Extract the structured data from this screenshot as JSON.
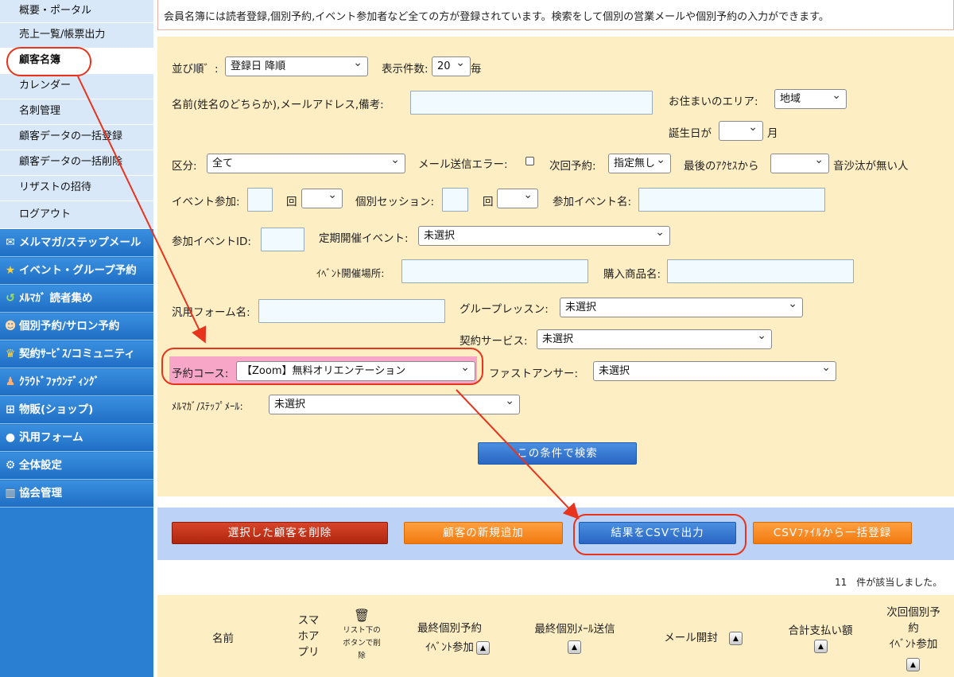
{
  "sidebar": {
    "sub_items": [
      {
        "label": "概要・ポータル"
      },
      {
        "label": "売上一覧/帳票出力"
      },
      {
        "label": "顧客名簿"
      },
      {
        "label": "カレンダー"
      },
      {
        "label": "名刺管理"
      },
      {
        "label": "顧客データの一括登録"
      },
      {
        "label": "顧客データの一括削除"
      },
      {
        "label": "リザストの招待"
      },
      {
        "label": "ログアウト"
      }
    ],
    "main_items": [
      {
        "label": "メルマガ/ステップメール",
        "icon": "envelope-icon"
      },
      {
        "label": "イベント・グループ予約",
        "icon": "star-icon"
      },
      {
        "label": "ﾒﾙﾏｶﾞ 読者集め",
        "icon": "recycle-icon"
      },
      {
        "label": "個別予約/サロン予約",
        "icon": "group-icon"
      },
      {
        "label": "契約ｻｰﾋﾞｽ/コミュニティ",
        "icon": "trophy-icon"
      },
      {
        "label": "ｸﾗｳﾄﾞﾌｧｳﾝﾃﾞｨﾝｸﾞ",
        "icon": "person-icon"
      },
      {
        "label": "物販(ショップ)",
        "icon": "cart-icon"
      },
      {
        "label": "汎用フォーム",
        "icon": "speech-bubble-icon"
      },
      {
        "label": "全体設定",
        "icon": "gear-icon"
      },
      {
        "label": "協会管理",
        "icon": "building-icon"
      }
    ]
  },
  "notice": "会員名簿には読者登録,個別予約,イベント参加者など全ての方が登録されています。検索をして個別の営業メールや個別予約の入力ができます。",
  "search": {
    "sort_label": "並び順゛:",
    "sort_value": "登録日 降順",
    "count_label": "表示件数:",
    "count_value": "20",
    "count_suffix": "毎",
    "name_label": "名前(姓名のどちらか),メールアドレス,備考:",
    "area_label": "お住まいのエリア:",
    "area_value": "地域",
    "birthday_label": "誕生日が",
    "birthday_value": "",
    "birthday_suffix": "月",
    "category_label": "区分:",
    "category_value": "全て",
    "mail_error_label": "メール送信エラー:",
    "next_label": "次回予約:",
    "next_value": "指定無し",
    "last_access_label": "最後のｱｸｾｽから",
    "last_access_value": "",
    "no_contact_label": "音沙汰が無い人",
    "event_count_label": "イベント参加:",
    "times_label_1": "回",
    "session_label": "個別セッション:",
    "times_label_2": "回",
    "event_name_label": "参加イベント名:",
    "event_id_label": "参加イベントID:",
    "regular_event_label": "定期開催イベント:",
    "regular_event_value": "未選択",
    "venue_label": "ｲﾍﾞﾝﾄ開催場所:",
    "product_label": "購入商品名:",
    "form_label": "汎用フォーム名:",
    "group_lesson_label": "グループレッスン:",
    "group_lesson_value": "未選択",
    "contract_label": "契約サービス:",
    "contract_value": "未選択",
    "course_label": "予約コース:",
    "course_value": "【Zoom】無料オリエンテーション",
    "fast_answer_label": "ファストアンサー:",
    "fast_answer_value": "未選択",
    "mailmag_label": "ﾒﾙﾏｶﾞ/ｽﾃｯﾌﾟﾒｰﾙ:",
    "mailmag_value": "未選択",
    "search_button": "この条件で検索"
  },
  "actions": {
    "delete": "選択した顧客を削除",
    "add": "顧客の新規追加",
    "export": "結果をCSVで出力",
    "import": "CSVﾌｧｲﾙから一括登録"
  },
  "result_count": "11　件が該当しました。",
  "table": {
    "col_name": "名前",
    "col_app": "スマ\nホア\nプリ",
    "col_trash_note": "リスト下の\nボタンで削\n除",
    "col_last_booking": "最終個別予約\nｲﾍﾞﾝﾄ参加",
    "col_last_mail": "最終個別ﾒｰﾙ送信",
    "col_mail_open": "メール開封",
    "col_total_paid": "合計支払い額",
    "col_next_booking": "次回個別予\n約\nｲﾍﾞﾝﾄ参加",
    "sort_glyph": "▲"
  },
  "colors": {
    "sidebar_blue": "#2a7fd3",
    "panel_beige": "#fdeec4",
    "action_bar": "#bcd3f7",
    "annotation_red": "#e8341c",
    "highlight_pink": "#f7a6c8"
  }
}
